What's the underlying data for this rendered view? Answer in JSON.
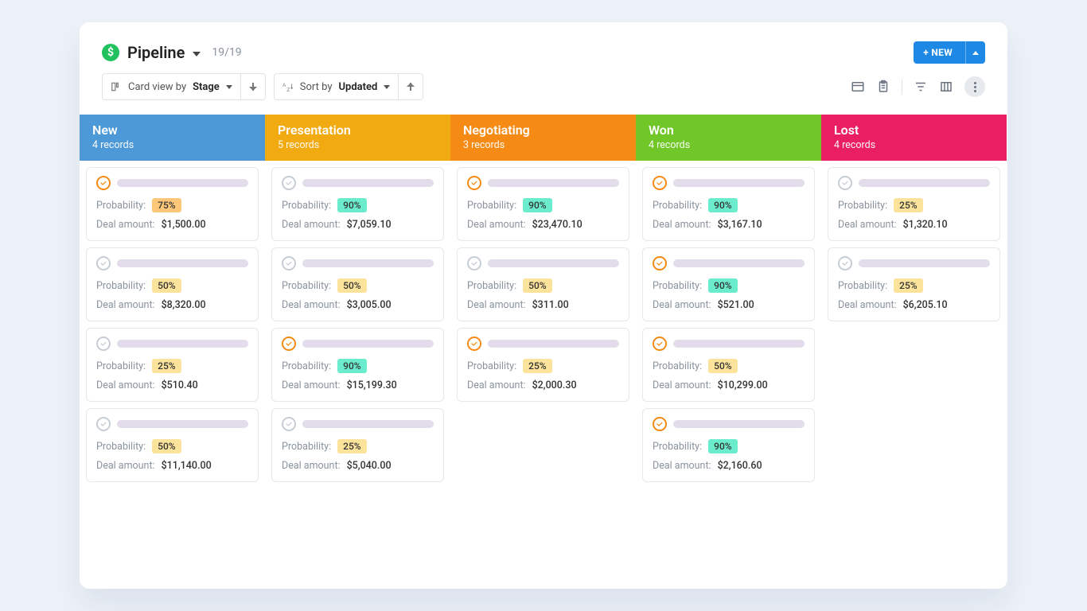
{
  "header": {
    "title": "Pipeline",
    "count": "19/19"
  },
  "actions": {
    "new_label": "+ NEW"
  },
  "toolbar": {
    "cardview_prefix": "Card view by",
    "cardview_field": "Stage",
    "sort_prefix": "Sort by",
    "sort_field": "Updated"
  },
  "labels": {
    "probability": "Probability:",
    "deal_amount": "Deal amount:"
  },
  "probability_colors": {
    "90": "teal",
    "75": "orange",
    "50": "yellow",
    "25": "yellow"
  },
  "columns": [
    {
      "key": "new",
      "title": "New",
      "subtitle": "4 records",
      "css": "c-new",
      "cards": [
        {
          "check": "orange",
          "prob": "75%",
          "amount": "$1,500.00"
        },
        {
          "check": "gray",
          "prob": "50%",
          "amount": "$8,320.00"
        },
        {
          "check": "gray",
          "prob": "25%",
          "amount": "$510.40"
        },
        {
          "check": "gray",
          "prob": "50%",
          "amount": "$11,140.00"
        }
      ]
    },
    {
      "key": "presentation",
      "title": "Presentation",
      "subtitle": "5 records",
      "css": "c-presentation",
      "cards": [
        {
          "check": "gray",
          "prob": "90%",
          "amount": "$7,059.10"
        },
        {
          "check": "gray",
          "prob": "50%",
          "amount": "$3,005.00"
        },
        {
          "check": "orange",
          "prob": "90%",
          "amount": "$15,199.30"
        },
        {
          "check": "gray",
          "prob": "25%",
          "amount": "$5,040.00"
        }
      ]
    },
    {
      "key": "negotiating",
      "title": "Negotiating",
      "subtitle": "3 records",
      "css": "c-negotiating",
      "cards": [
        {
          "check": "orange",
          "prob": "90%",
          "amount": "$23,470.10"
        },
        {
          "check": "gray",
          "prob": "50%",
          "amount": "$311.00"
        },
        {
          "check": "orange",
          "prob": "25%",
          "amount": "$2,000.30"
        }
      ]
    },
    {
      "key": "won",
      "title": "Won",
      "subtitle": "4 records",
      "css": "c-won",
      "cards": [
        {
          "check": "orange",
          "prob": "90%",
          "amount": "$3,167.10"
        },
        {
          "check": "orange",
          "prob": "90%",
          "amount": "$521.00"
        },
        {
          "check": "orange",
          "prob": "50%",
          "amount": "$10,299.00"
        },
        {
          "check": "orange",
          "prob": "90%",
          "amount": "$2,160.60"
        }
      ]
    },
    {
      "key": "lost",
      "title": "Lost",
      "subtitle": "4 records",
      "css": "c-lost",
      "cards": [
        {
          "check": "gray",
          "prob": "25%",
          "amount": "$1,320.10"
        },
        {
          "check": "gray",
          "prob": "25%",
          "amount": "$6,205.10"
        }
      ]
    }
  ]
}
